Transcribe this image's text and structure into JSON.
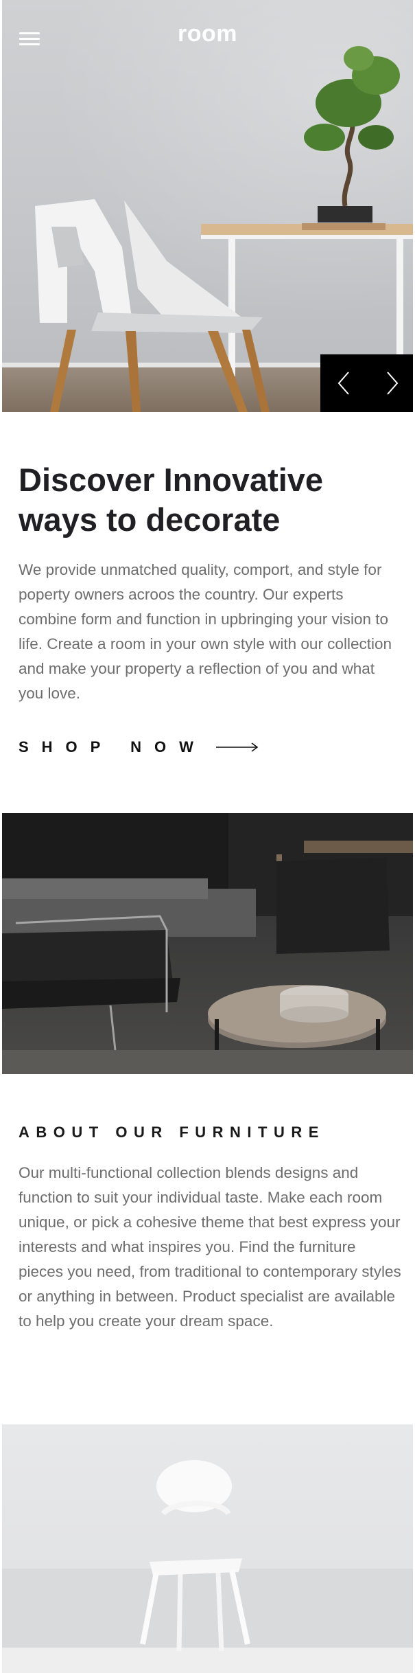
{
  "header": {
    "brand": "room",
    "menu_icon": "hamburger-menu-icon"
  },
  "hero": {
    "prev_icon": "chevron-left-icon",
    "next_icon": "chevron-right-icon"
  },
  "intro": {
    "title_line1": "Discover Innovative",
    "title_line2": "ways to decorate",
    "text": "We provide unmatched quality, comport, and style for poperty owners acroos the country. Our experts combine form and function in upbringing your vision to life. Create a room in your own style with our collection and make your property a reflection of you and what you love.",
    "cta_label": "SHOP NOW",
    "cta_icon": "arrow-right-icon"
  },
  "about": {
    "title": "ABOUT OUR FURNITURE",
    "text": "Our multi-functional collection blends designs and function to suit your individual taste. Make each room unique, or pick a cohesive theme that best express your interests and what inspires you. Find the furniture pieces you need, from traditional to contemporary styles or anything in between. Product specialist are available to help you create your dream space."
  },
  "colors": {
    "dark": "#000000",
    "heading": "#1f1f24",
    "body_text": "#6d6d6d",
    "white": "#ffffff"
  }
}
